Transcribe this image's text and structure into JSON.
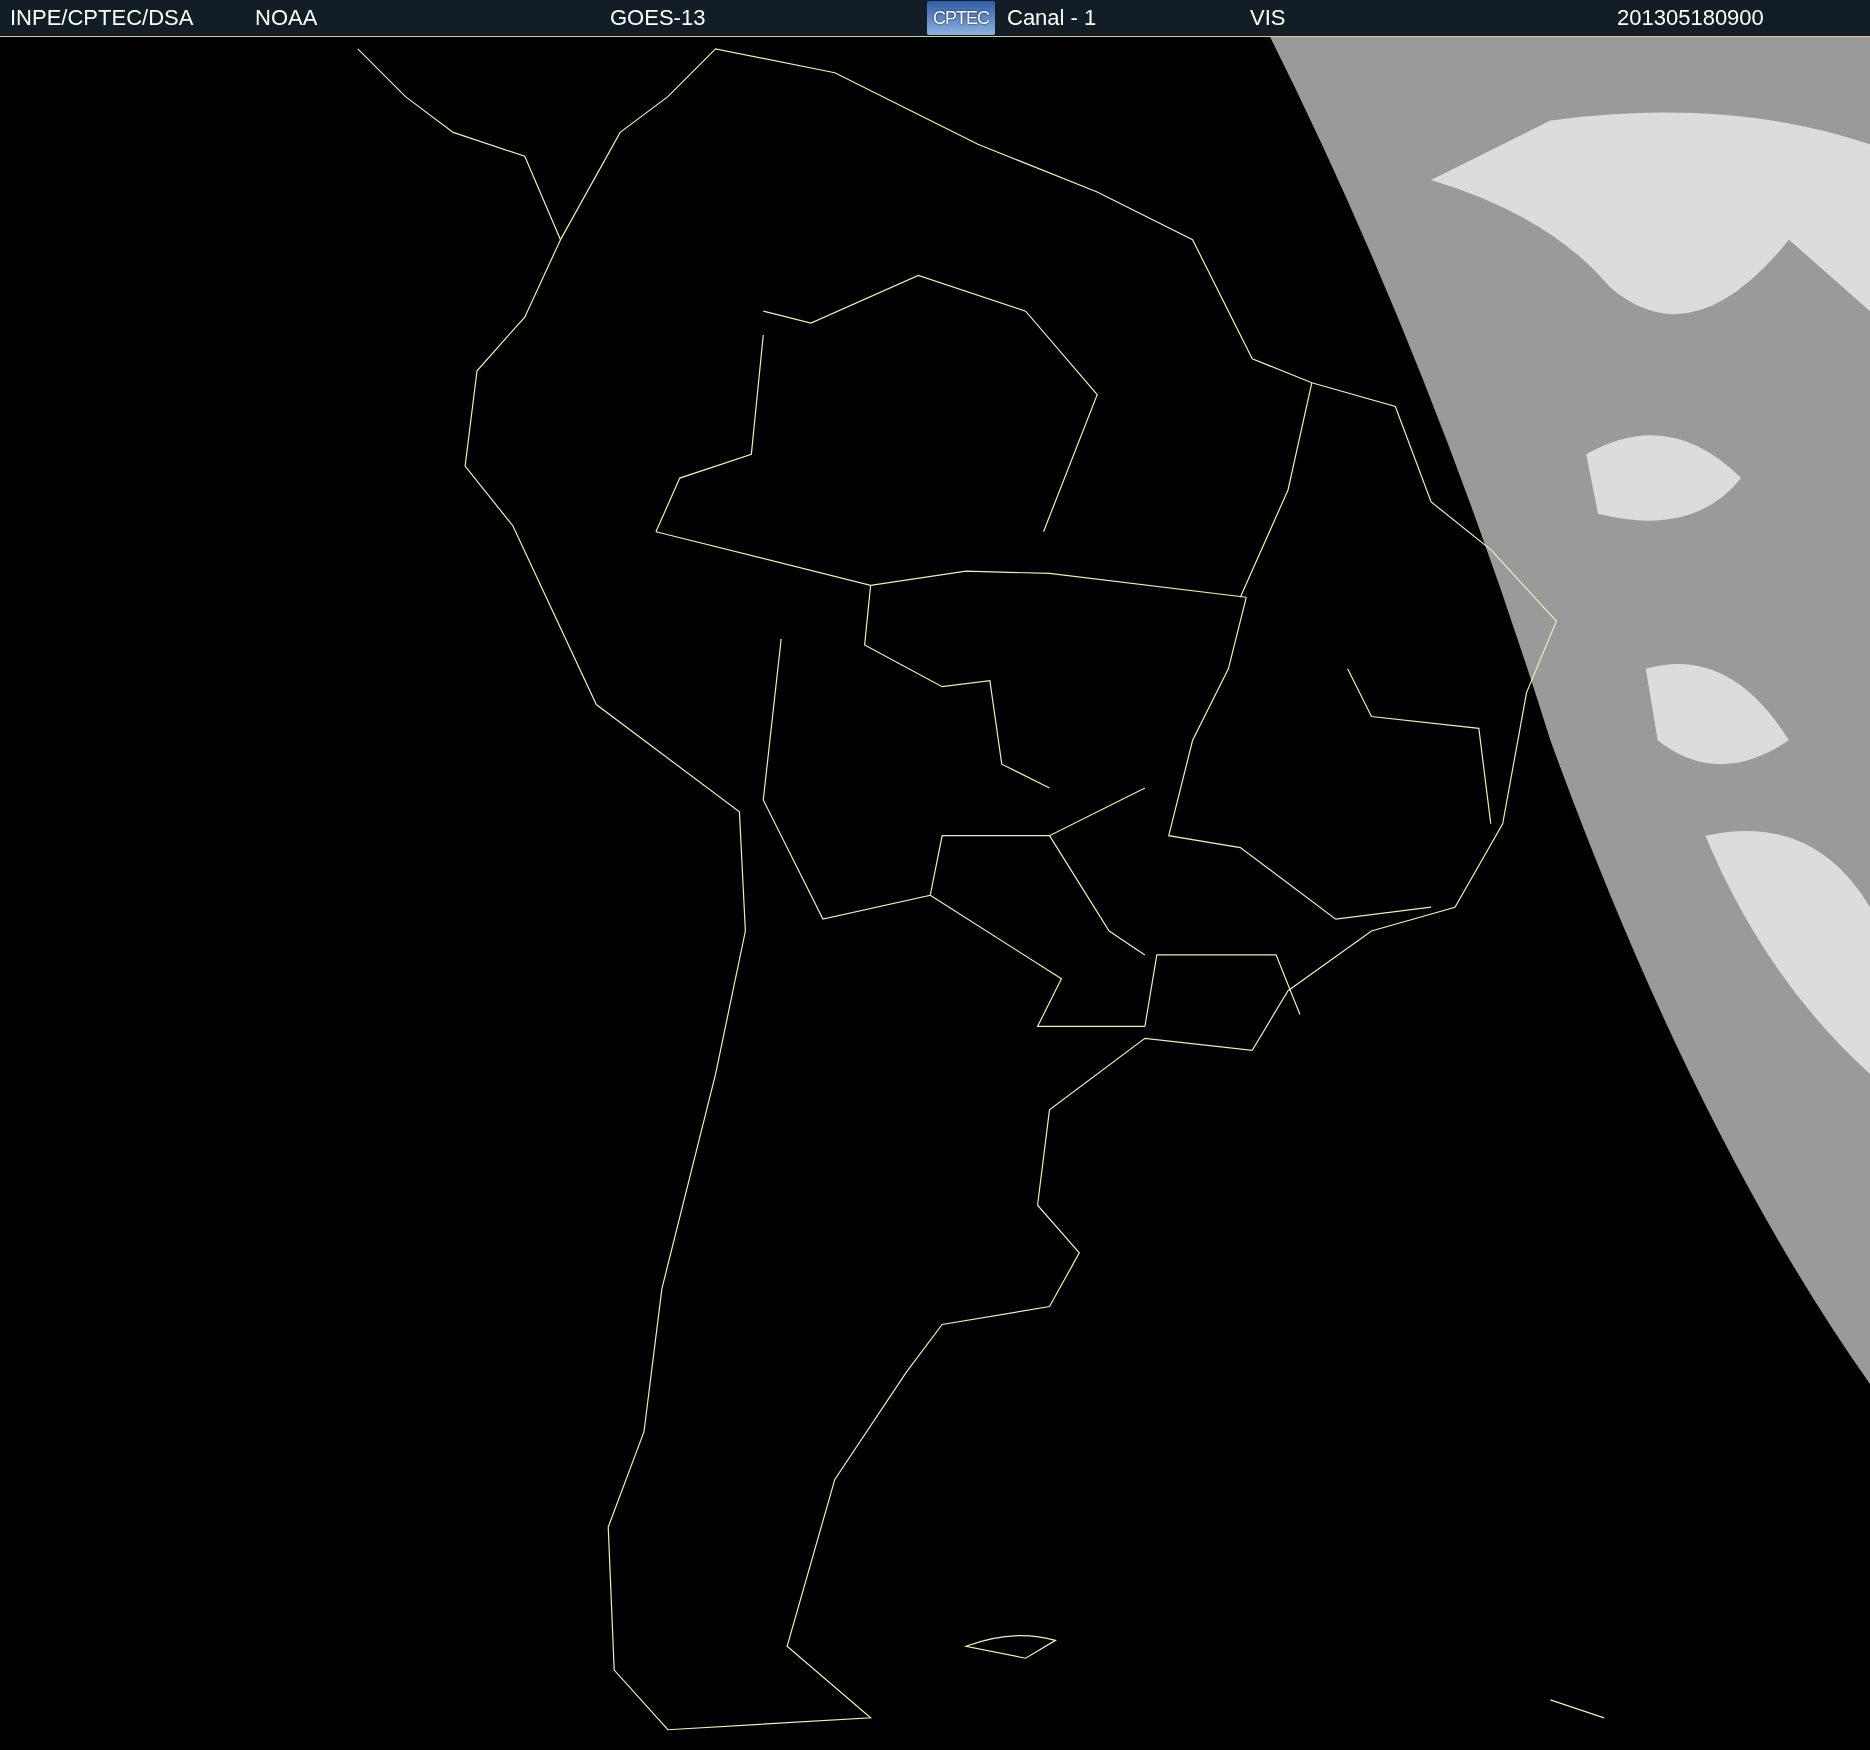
{
  "header": {
    "items": [
      {
        "kind": "text",
        "label": "INPE/CPTEC/DSA"
      },
      {
        "kind": "text",
        "label": "NOAA"
      },
      {
        "kind": "text",
        "label": "GOES-13"
      },
      {
        "kind": "logo",
        "label": "CPTEC"
      },
      {
        "kind": "text",
        "label": "Canal - 1"
      },
      {
        "kind": "text",
        "label": "VIS"
      },
      {
        "kind": "text",
        "label": "201305180900"
      }
    ]
  }
}
